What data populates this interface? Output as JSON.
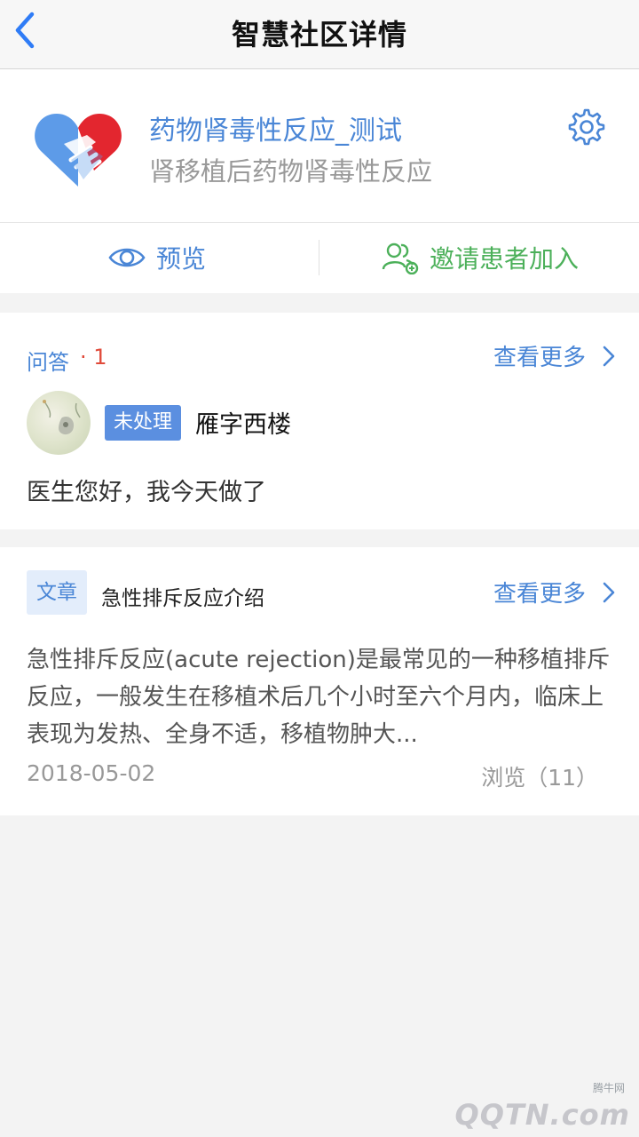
{
  "nav": {
    "title": "智慧社区详情"
  },
  "community": {
    "name": "药物肾毒性反应_测试",
    "description": "肾移植后药物肾毒性反应",
    "actions": {
      "preview": "预览",
      "invite": "邀请患者加入"
    }
  },
  "qa": {
    "label": "问答",
    "count": "· 1",
    "more": "查看更多",
    "item": {
      "status": "未处理",
      "asker": "雁字西楼",
      "question": "医生您好，我今天做了"
    }
  },
  "article": {
    "tag": "文章",
    "title": "急性排斥反应介绍",
    "more": "查看更多",
    "body": "急性排斥反应(acute rejection)是最常见的一种移植排斥反应，一般发生在移植术后几个小时至六个月内，临床上表现为发热、全身不适，移植物肿大...",
    "date": "2018-05-02",
    "views": "浏览（11）"
  },
  "watermark": {
    "small": "腾牛网",
    "big": "QQTN.com"
  },
  "colors": {
    "accent": "#4a86d6",
    "green": "#4cb05a",
    "red": "#e04a3a",
    "badge": "#5b8fe0"
  }
}
